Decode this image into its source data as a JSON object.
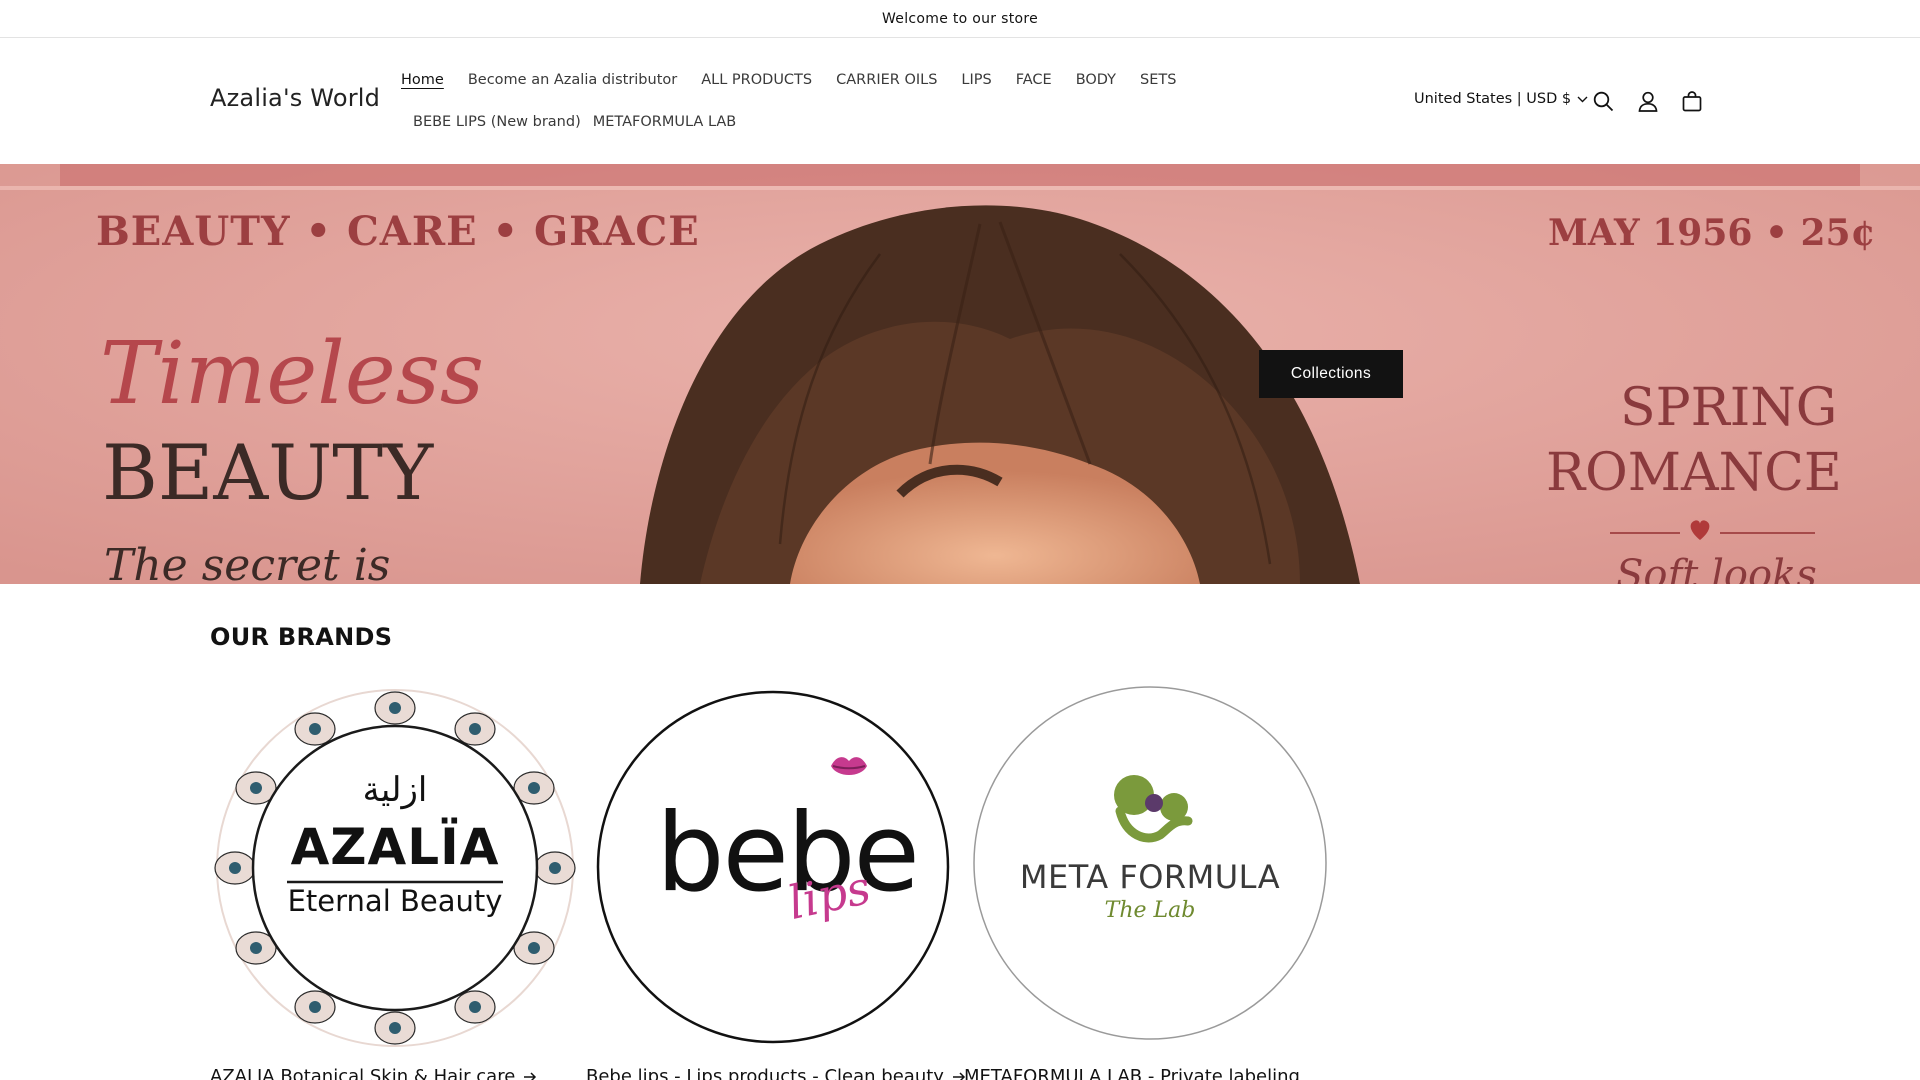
{
  "announcement": {
    "text": "Welcome to our store"
  },
  "header": {
    "logo": "Azalia's World",
    "nav": [
      {
        "label": "Home",
        "active": true
      },
      {
        "label": "Become an Azalia distributor"
      },
      {
        "label": "ALL PRODUCTS"
      },
      {
        "label": "CARRIER OILS"
      },
      {
        "label": "LIPS"
      },
      {
        "label": "FACE"
      },
      {
        "label": "BODY"
      },
      {
        "label": "SETS"
      },
      {
        "label": "BEBE LIPS (New brand)"
      },
      {
        "label": "METAFORMULA LAB"
      }
    ],
    "locale": "United States | USD $",
    "icons": [
      "search-icon",
      "account-icon",
      "cart-icon"
    ]
  },
  "hero": {
    "masthead_left": "BEAUTY • CARE • GRACE",
    "masthead_right": "MAY 1956 • 25¢",
    "headline_script": "Timeless",
    "headline_main": "BEAUTY",
    "tagline": "The secret is",
    "right_line1": "SPRING",
    "right_line2": "ROMANCE",
    "right_tagline": "Soft looks",
    "button_label": "Collections",
    "colors": {
      "background": "#e5a8a1",
      "ink": "#9c3f41",
      "hair": "#4a2e20",
      "skin": "#e0a383"
    }
  },
  "brands": {
    "title": "OUR BRANDS",
    "items": [
      {
        "logo_arabic": "ازلية",
        "logo_name": "AZALÏA",
        "logo_tagline": "Eternal Beauty",
        "link": "AZALIA Botanical Skin & Hair care"
      },
      {
        "logo_main": "bebe",
        "logo_script": "lips",
        "link": "Bebe lips - Lips products - Clean beauty"
      },
      {
        "logo_main": "META FORMULA",
        "logo_script": "The Lab",
        "link": "METAFORMULA LAB - Private labeling"
      }
    ]
  }
}
